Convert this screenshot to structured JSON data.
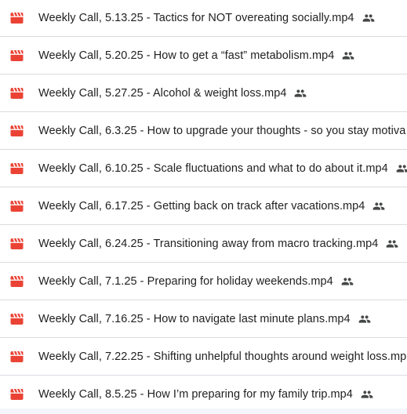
{
  "colors": {
    "video_icon": "#ea4335",
    "text": "#1f1f1f",
    "shared_icon": "#444746",
    "divider": "#dadce0"
  },
  "icons": {
    "file_type": "video-file-icon",
    "shared": "shared-people-icon"
  },
  "files": [
    {
      "name": "Weekly Call, 5.13.25 - Tactics for NOT overeating socially.mp4",
      "shared": true
    },
    {
      "name": "Weekly Call, 5.20.25 - How to get a “fast” metabolism.mp4",
      "shared": true
    },
    {
      "name": "Weekly Call, 5.27.25 - Alcohol & weight loss.mp4",
      "shared": true
    },
    {
      "name": "Weekly Call, 6.3.25 - How to upgrade your thoughts - so you stay motiva",
      "shared": false
    },
    {
      "name": "Weekly Call, 6.10.25 - Scale fluctuations and what to do about it.mp4",
      "shared": true
    },
    {
      "name": "Weekly Call, 6.17.25 - Getting back on track after vacations.mp4",
      "shared": true
    },
    {
      "name": "Weekly Call, 6.24.25 - Transitioning away from macro tracking.mp4",
      "shared": true
    },
    {
      "name": "Weekly Call, 7.1.25 - Preparing for holiday weekends.mp4",
      "shared": true
    },
    {
      "name": "Weekly Call, 7.16.25 - How to navigate last minute plans.mp4",
      "shared": true
    },
    {
      "name": "Weekly Call, 7.22.25 - Shifting unhelpful thoughts around weight loss.mp",
      "shared": false
    },
    {
      "name": "Weekly Call, 8.5.25 - How I’m preparing for my family trip.mp4",
      "shared": true
    }
  ]
}
